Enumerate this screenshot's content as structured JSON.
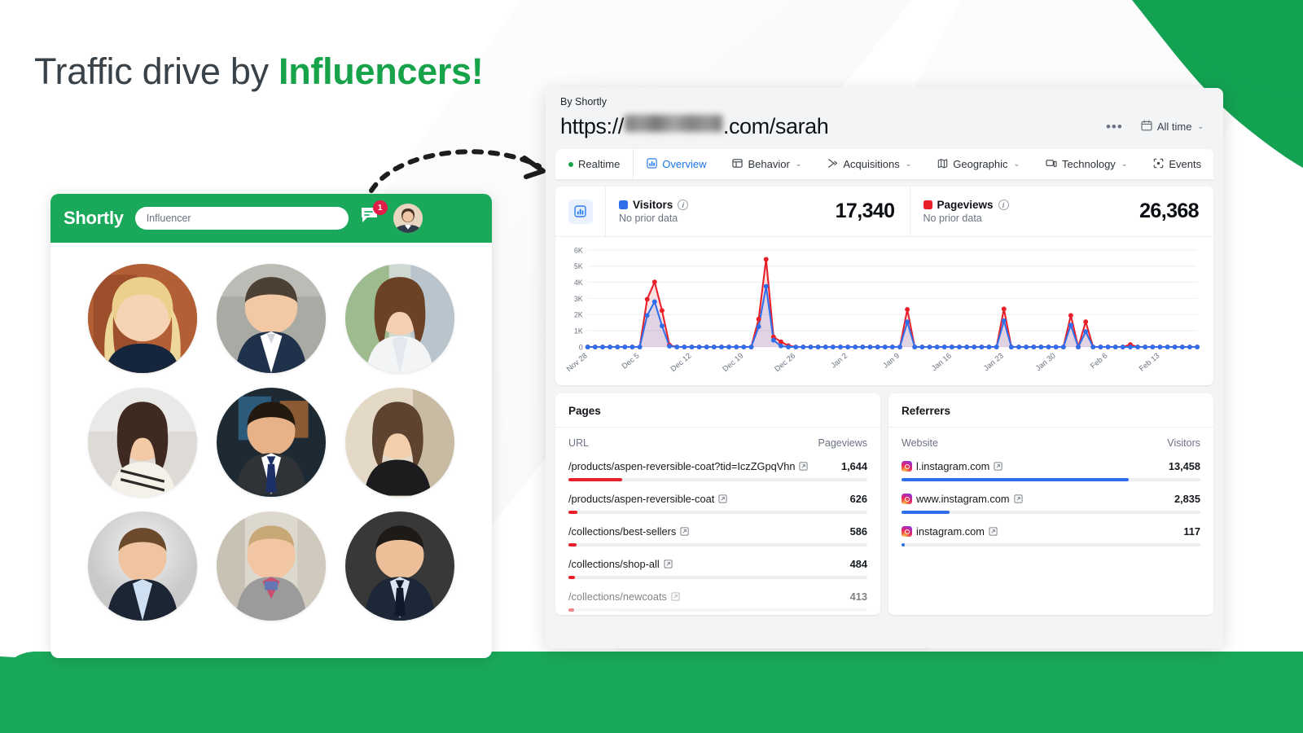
{
  "headline": {
    "plain": "Traffic drive by ",
    "accent": "Influencers!"
  },
  "brand_colors": {
    "green": "#1aa85a",
    "accent_blue": "#1a73e8",
    "red": "#e8202a",
    "visitors_blue": "#2f6fec"
  },
  "influencer_panel": {
    "logo": "Shortly",
    "search_value": "Influencer",
    "search_placeholder": "Influencer",
    "chat_icon": "chat-icon",
    "chat_badge_count": "1",
    "avatar_icon": "user-avatar",
    "avatar_count": 9
  },
  "dashboard": {
    "byline": "By Shortly",
    "url_prefix": "https://",
    "url_suffix": ".com/sarah",
    "url_redacted": true,
    "kebab_label": "•••",
    "daterange": {
      "icon": "calendar-icon",
      "label": "All time",
      "caret": "⌄"
    },
    "tabs": [
      {
        "label": "Realtime",
        "icon": "live-dot-icon",
        "caret": false,
        "active": false
      },
      {
        "label": "Overview",
        "icon": "bar-chart-icon",
        "caret": false,
        "active": true
      },
      {
        "label": "Behavior",
        "icon": "behavior-icon",
        "caret": true,
        "active": false
      },
      {
        "label": "Acquisitions",
        "icon": "acquisitions-icon",
        "caret": true,
        "active": false
      },
      {
        "label": "Geographic",
        "icon": "map-icon",
        "caret": true,
        "active": false
      },
      {
        "label": "Technology",
        "icon": "device-icon",
        "caret": true,
        "active": false
      },
      {
        "label": "Events",
        "icon": "events-icon",
        "caret": false,
        "active": false
      }
    ],
    "stats": {
      "panel_icon": "bar-chart-icon",
      "items": [
        {
          "name": "Visitors",
          "sub": "No prior data",
          "value": "17,340",
          "color": "#2f6fec"
        },
        {
          "name": "Pageviews",
          "sub": "No prior data",
          "value": "26,368",
          "color": "#e8202a"
        }
      ]
    },
    "pages_table": {
      "title": "Pages",
      "col_url": "URL",
      "col_value": "Pageviews",
      "bar_color": "#e8202a",
      "rows": [
        {
          "label": "/products/aspen-reversible-coat?tid=IczZGpqVhn",
          "value": "1,644",
          "pct": 18
        },
        {
          "label": "/products/aspen-reversible-coat",
          "value": "626",
          "pct": 3
        },
        {
          "label": "/collections/best-sellers",
          "value": "586",
          "pct": 2.6
        },
        {
          "label": "/collections/shop-all",
          "value": "484",
          "pct": 2.2
        },
        {
          "label": "/collections/newcoats",
          "value": "413",
          "pct": 1.9
        }
      ]
    },
    "referrers_table": {
      "title": "Referrers",
      "col_url": "Website",
      "col_value": "Visitors",
      "bar_color": "#2f6fec",
      "rows": [
        {
          "label": "l.instagram.com",
          "value": "13,458",
          "pct": 76
        },
        {
          "label": "www.instagram.com",
          "value": "2,835",
          "pct": 16
        },
        {
          "label": "instagram.com",
          "value": "117",
          "pct": 1
        }
      ]
    }
  },
  "chart_data": {
    "type": "line",
    "title": "",
    "xlabel": "",
    "ylabel": "",
    "ylim": [
      0,
      6000
    ],
    "ytick_labels": [
      "0",
      "1K",
      "2K",
      "3K",
      "4K",
      "5K",
      "6K"
    ],
    "yticks": [
      0,
      1000,
      2000,
      3000,
      4000,
      5000,
      6000
    ],
    "grid": true,
    "legend_position": "top",
    "tick_labels": [
      "Nov 28",
      "Dec 5",
      "Dec 12",
      "Dec 19",
      "Dec 26",
      "Jan 2",
      "Jan 9",
      "Jan 16",
      "Jan 23",
      "Jan 30",
      "Feb 6",
      "Feb 13"
    ],
    "tick_indices": [
      0,
      7,
      14,
      21,
      28,
      35,
      42,
      49,
      56,
      63,
      70,
      77
    ],
    "series": [
      {
        "name": "Visitors",
        "color": "#2f6fec",
        "values": [
          0,
          0,
          0,
          0,
          0,
          0,
          0,
          0,
          1950,
          2800,
          1300,
          50,
          0,
          0,
          0,
          0,
          0,
          0,
          0,
          0,
          0,
          0,
          0,
          1250,
          3750,
          420,
          60,
          0,
          0,
          0,
          0,
          0,
          0,
          0,
          0,
          0,
          0,
          0,
          0,
          0,
          0,
          0,
          0,
          1550,
          0,
          0,
          0,
          0,
          0,
          0,
          0,
          0,
          0,
          0,
          0,
          0,
          1620,
          0,
          0,
          0,
          0,
          0,
          0,
          0,
          0,
          1350,
          0,
          950,
          0,
          0,
          0,
          0,
          0,
          0,
          0,
          0,
          0,
          0,
          0,
          0,
          0,
          0,
          0
        ]
      },
      {
        "name": "Pageviews",
        "color": "#e8202a",
        "values": [
          0,
          0,
          0,
          0,
          0,
          0,
          0,
          0,
          2950,
          4020,
          2250,
          120,
          0,
          0,
          0,
          0,
          0,
          0,
          0,
          0,
          0,
          0,
          0,
          1720,
          5420,
          620,
          320,
          80,
          0,
          0,
          0,
          0,
          0,
          0,
          0,
          0,
          0,
          0,
          0,
          0,
          0,
          0,
          0,
          2320,
          0,
          0,
          0,
          0,
          0,
          0,
          0,
          0,
          0,
          0,
          0,
          0,
          2350,
          0,
          0,
          0,
          0,
          0,
          0,
          0,
          0,
          1950,
          0,
          1560,
          0,
          0,
          0,
          0,
          0,
          150,
          0,
          0,
          0,
          0,
          0,
          0,
          0,
          0,
          0
        ]
      }
    ]
  }
}
